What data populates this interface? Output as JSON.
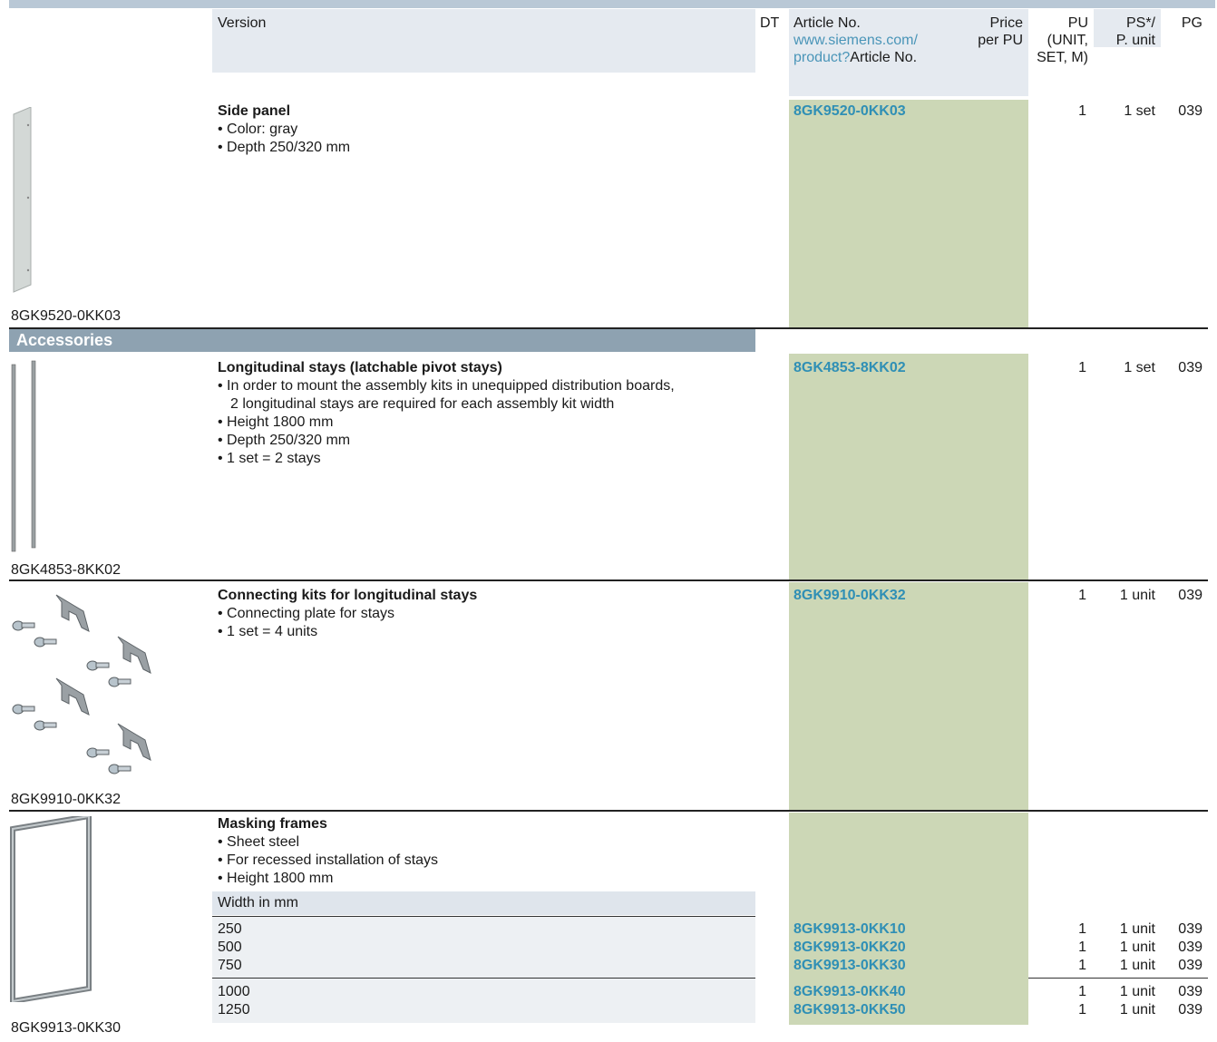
{
  "header": {
    "version": "Version",
    "dt": "DT",
    "article_no": "Article No.",
    "article_link_1": "www.siemens.com/",
    "article_link_2": "product?",
    "article_link_3": "Article No.",
    "price_1": "Price",
    "price_2": "per PU",
    "pu_1": "PU",
    "pu_2": "(UNIT,",
    "pu_3": "SET, M)",
    "ps_1": "PS*/",
    "ps_2": "P. unit",
    "pg": "PG"
  },
  "items": [
    {
      "title": "Side panel",
      "bullets": [
        "• Color: gray",
        "• Depth 250/320 mm"
      ],
      "article": "8GK9520-0KK03",
      "pu": "1",
      "ps": "1 set",
      "pg": "039",
      "caption": "8GK9520-0KK03"
    },
    {
      "title": "Longitudinal stays (latchable pivot stays)",
      "bullets": [
        "• In order to mount the assembly kits in unequipped distribution boards,",
        "2 longitudinal stays are required for each assembly kit width",
        "• Height 1800 mm",
        "• Depth 250/320 mm",
        "• 1 set = 2 stays"
      ],
      "article": "8GK4853-8KK02",
      "pu": "1",
      "ps": "1 set",
      "pg": "039",
      "caption": "8GK4853-8KK02"
    },
    {
      "title": "Connecting kits for longitudinal stays",
      "bullets": [
        "• Connecting plate for stays",
        "• 1 set = 4 units"
      ],
      "article": "8GK9910-0KK32",
      "pu": "1",
      "ps": "1 unit",
      "pg": "039",
      "caption": "8GK9910-0KK32"
    },
    {
      "title": "Masking frames",
      "bullets": [
        "• Sheet steel",
        "• For recessed installation of stays",
        "• Height 1800 mm"
      ],
      "caption": "8GK9913-0KK30",
      "width_header": "Width in mm",
      "rows": [
        {
          "width": "250",
          "article": "8GK9913-0KK10",
          "pu": "1",
          "ps": "1 unit",
          "pg": "039"
        },
        {
          "width": "500",
          "article": "8GK9913-0KK20",
          "pu": "1",
          "ps": "1 unit",
          "pg": "039"
        },
        {
          "width": "750",
          "article": "8GK9913-0KK30",
          "pu": "1",
          "ps": "1 unit",
          "pg": "039"
        },
        {
          "width": "1000",
          "article": "8GK9913-0KK40",
          "pu": "1",
          "ps": "1 unit",
          "pg": "039"
        },
        {
          "width": "1250",
          "article": "8GK9913-0KK50",
          "pu": "1",
          "ps": "1 unit",
          "pg": "039"
        }
      ]
    }
  ],
  "accessories_label": "Accessories"
}
